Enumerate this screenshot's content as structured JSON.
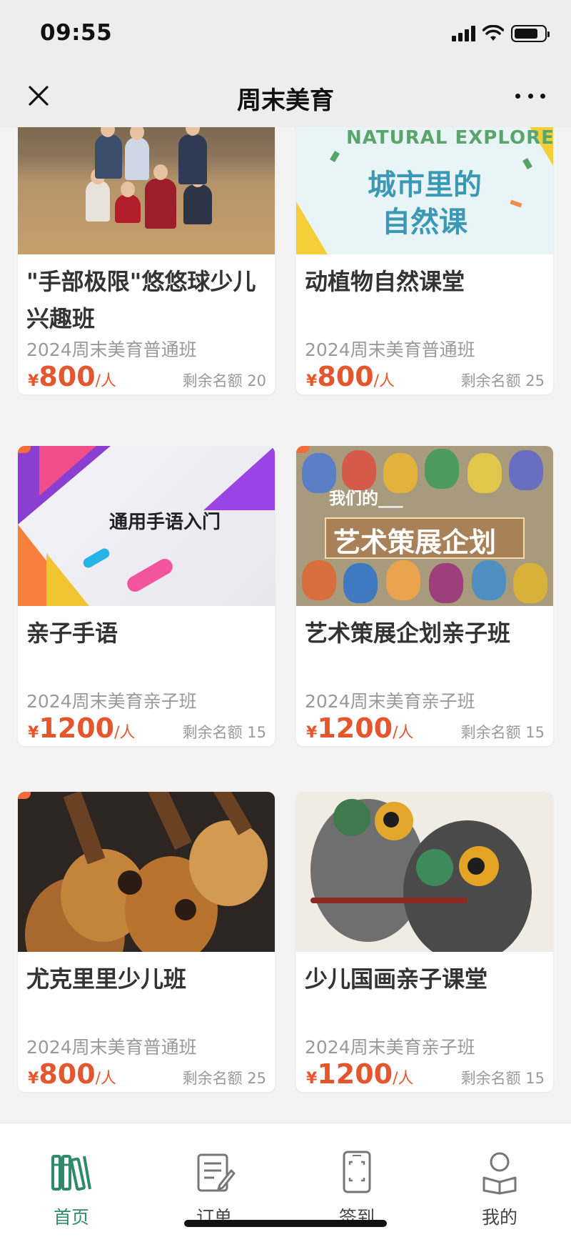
{
  "status_bar": {
    "time": "09:55"
  },
  "header": {
    "title": "周末美育"
  },
  "courses": [
    {
      "title": "\"手部极限\"悠悠球少儿兴趣班",
      "subtitle": "2024周末美育普通班",
      "currency": "¥",
      "price": "800",
      "unit": "/人",
      "quota": "剩余名额 20"
    },
    {
      "title": "动植物自然课堂",
      "subtitle": "2024周末美育普通班",
      "currency": "¥",
      "price": "800",
      "unit": "/人",
      "quota": "剩余名额 25",
      "image_text": [
        "NATURAL EXPLORE",
        "城市里的",
        "自然课"
      ]
    },
    {
      "title": "亲子手语",
      "subtitle": "2024周末美育亲子班",
      "currency": "¥",
      "price": "1200",
      "unit": "/人",
      "quota": "剩余名额 15",
      "image_text": [
        "通用手语入门"
      ]
    },
    {
      "title": "艺术策展企划亲子班",
      "subtitle": "2024周末美育亲子班",
      "currency": "¥",
      "price": "1200",
      "unit": "/人",
      "quota": "剩余名额 15",
      "image_text": [
        "我们的___",
        "艺术策展企划"
      ]
    },
    {
      "title": "尤克里里少儿班",
      "subtitle": "2024周末美育普通班",
      "currency": "¥",
      "price": "800",
      "unit": "/人",
      "quota": "剩余名额 25"
    },
    {
      "title": "少儿国画亲子课堂",
      "subtitle": "2024周末美育亲子班",
      "currency": "¥",
      "price": "1200",
      "unit": "/人",
      "quota": "剩余名额 15"
    }
  ],
  "tabbar": {
    "items": [
      {
        "label": "首页",
        "icon": "books-icon",
        "active": true
      },
      {
        "label": "订单",
        "icon": "order-icon",
        "active": false
      },
      {
        "label": "签到",
        "icon": "scan-phone-icon",
        "active": false
      },
      {
        "label": "我的",
        "icon": "user-icon",
        "active": false
      }
    ]
  },
  "colors": {
    "accent": "#2e8a6a",
    "price": "#e4572e",
    "muted": "#999999"
  }
}
